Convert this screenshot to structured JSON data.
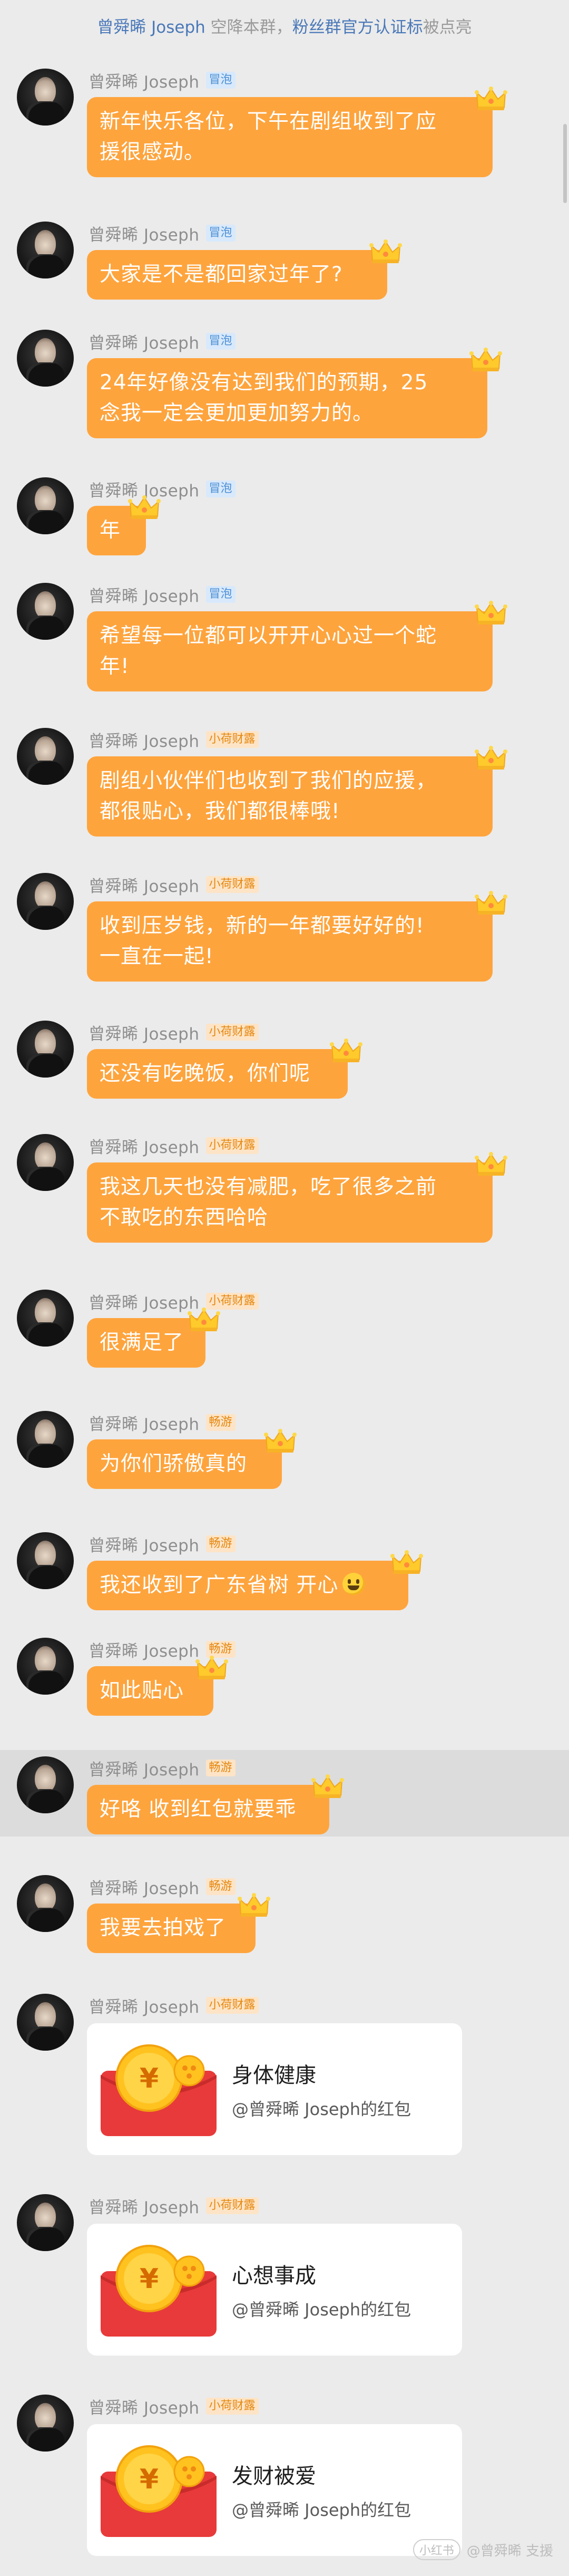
{
  "notice": {
    "user": "曾舜晞 Joseph",
    "text_before_link": " 空降本群，",
    "link": "粉丝群官方认证标",
    "text_after_link": "被点亮"
  },
  "colors": {
    "bubble": "#fea43d",
    "tag_blue_bg": "#d8e9fb",
    "tag_blue_text": "#4c8fd6",
    "tag_orange_bg": "#fde4c6",
    "tag_orange_text": "#e5870e"
  },
  "messages": [
    {
      "name": "曾舜晞 Joseph",
      "tag": "冒泡",
      "text": "新年快乐各位，下午在剧组收到了应\n援很感动。"
    },
    {
      "name": "曾舜晞 Joseph",
      "tag": "冒泡",
      "text": "大家是不是都回家过年了?"
    },
    {
      "name": "曾舜晞 Joseph",
      "tag": "冒泡",
      "text": "24年好像没有达到我们的预期，25\n念我一定会更加更加努力的。"
    },
    {
      "name": "曾舜晞 Joseph",
      "tag": "冒泡",
      "text": "年"
    },
    {
      "name": "曾舜晞 Joseph",
      "tag": "冒泡",
      "text": "希望每一位都可以开开心心过一个蛇\n年!"
    },
    {
      "name": "曾舜晞 Joseph",
      "tag": "小荷财露",
      "text": "剧组小伙伴们也收到了我们的应援，\n都很贴心，我们都很棒哦!"
    },
    {
      "name": "曾舜晞 Joseph",
      "tag": "小荷财露",
      "text": "收到压岁钱，新的一年都要好好的!\n一直在一起!"
    },
    {
      "name": "曾舜晞 Joseph",
      "tag": "小荷财露",
      "text": "还没有吃晚饭，你们呢"
    },
    {
      "name": "曾舜晞 Joseph",
      "tag": "小荷财露",
      "text": "我这几天也没有减肥，吃了很多之前\n不敢吃的东西哈哈"
    },
    {
      "name": "曾舜晞 Joseph",
      "tag": "小荷财露",
      "text": "很满足了"
    },
    {
      "name": "曾舜晞 Joseph",
      "tag": "畅游",
      "text": "为你们骄傲真的"
    },
    {
      "name": "曾舜晞 Joseph",
      "tag": "畅游",
      "text": "我还收到了广东省树 开心"
    },
    {
      "name": "曾舜晞 Joseph",
      "tag": "畅游",
      "text": "如此贴心"
    },
    {
      "name": "曾舜晞 Joseph",
      "tag": "畅游",
      "text": "好咯 收到红包就要乖"
    },
    {
      "name": "曾舜晞 Joseph",
      "tag": "畅游",
      "text": "我要去拍戏了"
    }
  ],
  "red_packets": [
    {
      "name": "曾舜晞 Joseph",
      "tag": "小荷财露",
      "title": "身体健康",
      "sub": "@曾舜晞 Joseph的红包"
    },
    {
      "name": "曾舜晞 Joseph",
      "tag": "小荷财露",
      "title": "心想事成",
      "sub": "@曾舜晞 Joseph的红包"
    },
    {
      "name": "曾舜晞 Joseph",
      "tag": "小荷财露",
      "title": "发财被爱",
      "sub": "@曾舜晞 Joseph的红包"
    }
  ],
  "watermark": {
    "badge": "小红书",
    "text": "@曾舜晞 支援"
  }
}
